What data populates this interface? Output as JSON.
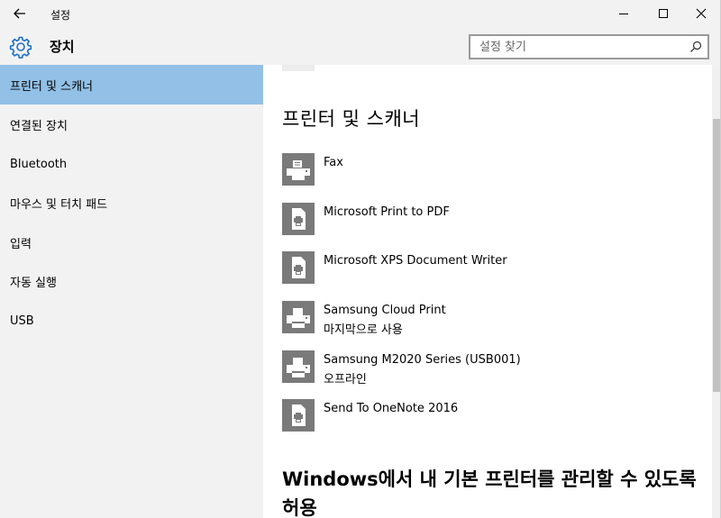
{
  "window": {
    "title": "설정",
    "back_icon": "back-arrow-icon",
    "min_icon": "minimize-icon",
    "max_icon": "maximize-icon",
    "close_icon": "close-icon"
  },
  "header": {
    "title": "장치",
    "icon": "gear-icon",
    "search_placeholder": "설정 찾기"
  },
  "sidebar": {
    "items": [
      {
        "label": "프린터 및 스캐너",
        "active": true
      },
      {
        "label": "연결된 장치"
      },
      {
        "label": "Bluetooth"
      },
      {
        "label": "마우스 및 터치 패드"
      },
      {
        "label": "입력"
      },
      {
        "label": "자동 실행"
      },
      {
        "label": "USB"
      }
    ]
  },
  "main": {
    "title": "프린터 및 스캐너",
    "devices": [
      {
        "name": "Fax",
        "status": "",
        "icon": "fax-printer-icon"
      },
      {
        "name": "Microsoft Print to PDF",
        "status": "",
        "icon": "document-printer-icon"
      },
      {
        "name": "Microsoft XPS Document Writer",
        "status": "",
        "icon": "document-printer-icon"
      },
      {
        "name": "Samsung Cloud Print",
        "status": "마지막으로 사용",
        "icon": "printer-icon"
      },
      {
        "name": "Samsung M2020 Series (USB001)",
        "status": "오프라인",
        "icon": "printer-icon"
      },
      {
        "name": "Send To OneNote 2016",
        "status": "",
        "icon": "document-printer-icon"
      }
    ],
    "default_printer_heading": "Windows에서 내 기본 프린터를 관리할 수 있도록 허용"
  },
  "colors": {
    "sidebar_bg": "#f2f2f2",
    "active_item": "#92c0e6",
    "accent": "#1e6fc7",
    "icon_tile": "#7a7a7a"
  }
}
